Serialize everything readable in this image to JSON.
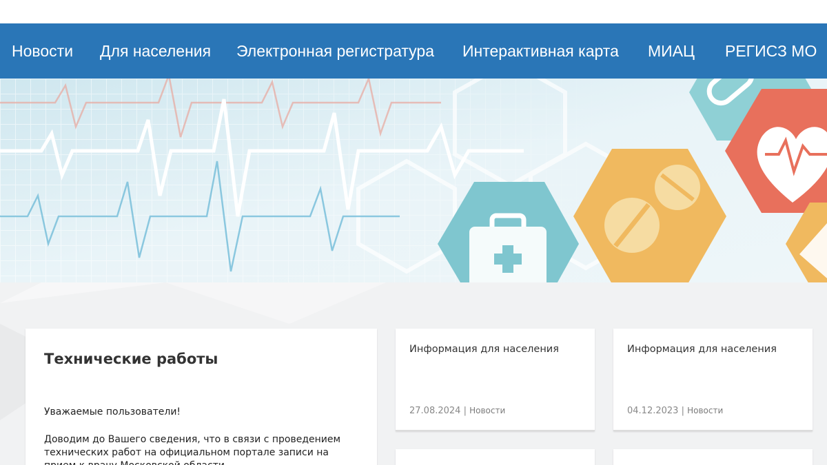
{
  "nav": {
    "items": [
      {
        "label": "Новости"
      },
      {
        "label": "Для населения"
      },
      {
        "label": "Электронная регистратура"
      },
      {
        "label": "Интерактивная карта"
      },
      {
        "label": "МИАЦ"
      },
      {
        "label": "РЕГИСЗ МО"
      }
    ]
  },
  "main_card": {
    "title": "Технические работы",
    "greeting": "Уважаемые пользователи!",
    "line1": "Доводим до Вашего сведения, что в связи с проведением",
    "line2": "технических работ на официальном портале записи на",
    "line3": "прием к врачу Московской области ..."
  },
  "news": [
    {
      "title": "Информация для населения",
      "date": "27.08.2024",
      "separator": "|",
      "category": "Новости"
    },
    {
      "title": "Информация для населения",
      "date": "04.12.2023",
      "separator": "|",
      "category": "Новости"
    }
  ],
  "colors": {
    "nav_bg": "#2a76b7",
    "content_bg": "#f1f2f3",
    "hex_teal": "#7fc6cf",
    "hex_orange": "#f0b95f",
    "hex_red": "#e8705c"
  }
}
